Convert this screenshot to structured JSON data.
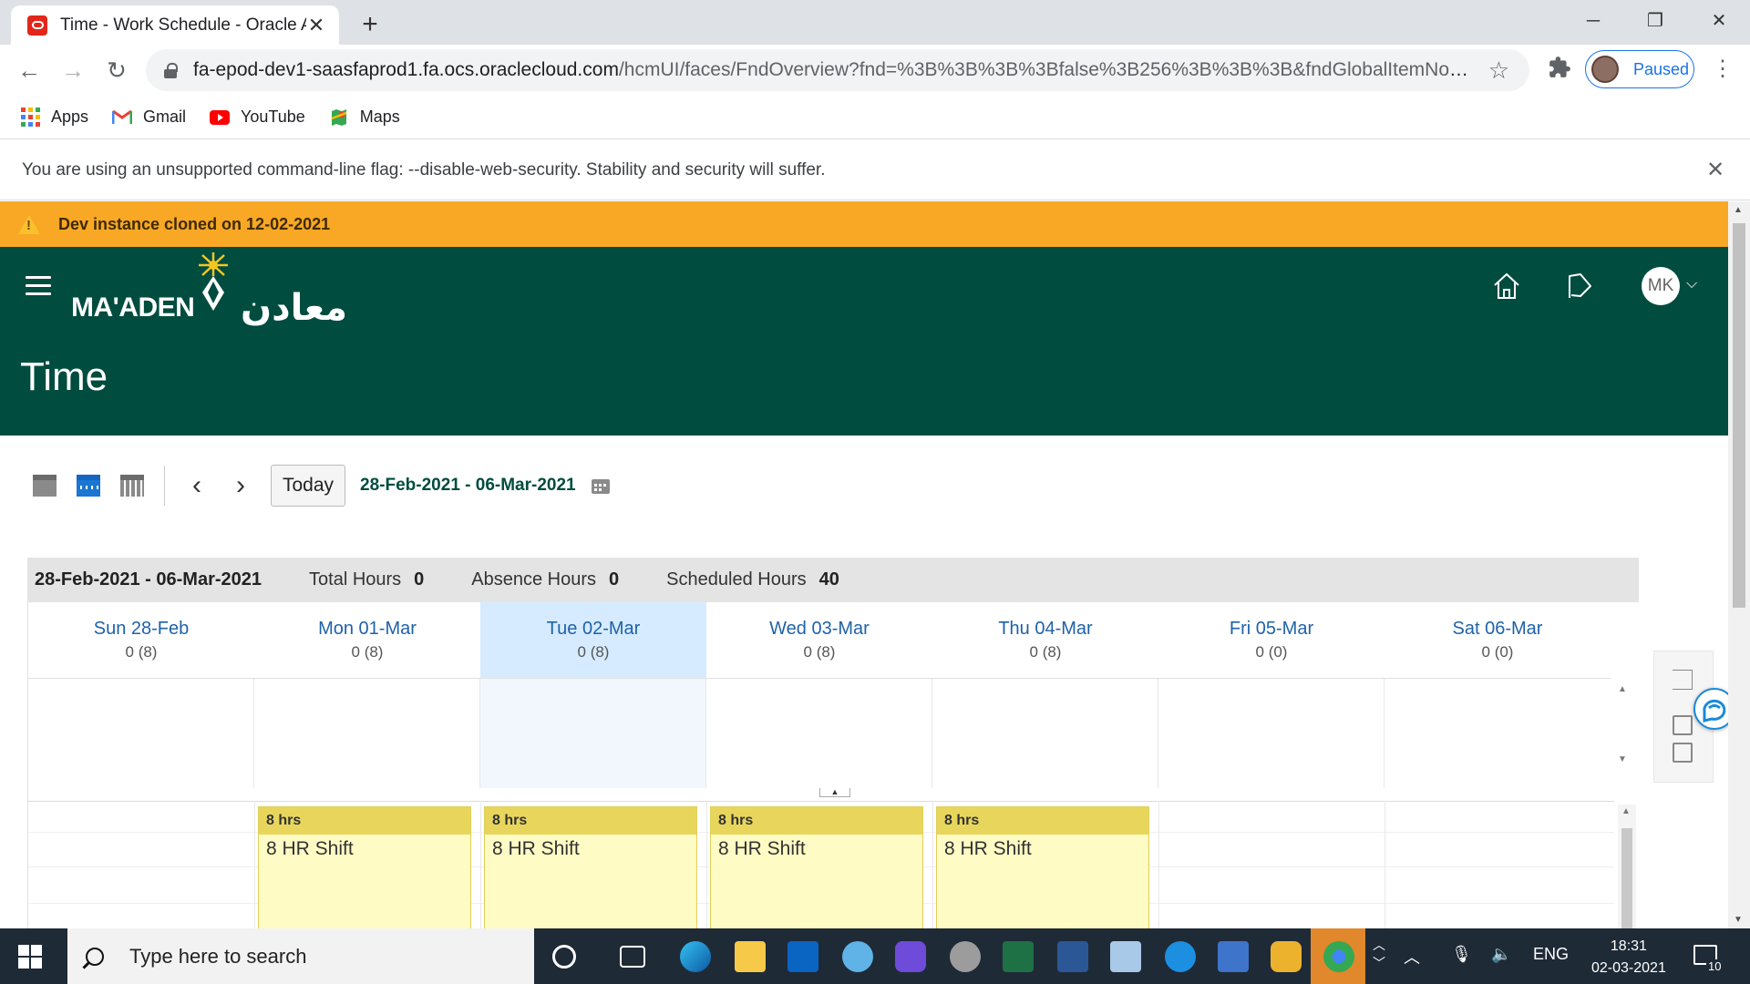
{
  "browser": {
    "tab_title": "Time - Work Schedule - Oracle Applications",
    "new_tab": "+",
    "url_host": "fa-epod-dev1-saasfaprod1.fa.ocs.oraclecloud.com",
    "url_path": "/hcmUI/faces/FndOverview?fnd=%3B%3B%3B%3Bfalse%3B256%3B%3B%3B&fndGlobalItemNodeId...",
    "profile_label": "Paused",
    "bookmarks": [
      {
        "label": "Apps",
        "icon": "apps-grid-icon"
      },
      {
        "label": "Gmail",
        "icon": "gmail-icon"
      },
      {
        "label": "YouTube",
        "icon": "youtube-icon"
      },
      {
        "label": "Maps",
        "icon": "maps-icon"
      }
    ],
    "infobar_text": "You are using an unsupported command-line flag: --disable-web-security. Stability and security will suffer."
  },
  "banner": {
    "text": "Dev instance cloned on 12-02-2021",
    "color": "#f9a825"
  },
  "header": {
    "logo_text": "MA'ADEN",
    "logo_arabic": "معادن",
    "title": "Time",
    "avatar_initials": "MK",
    "background": "#004c3f"
  },
  "calendar": {
    "today_label": "Today",
    "range": "28-Feb-2021 - 06-Mar-2021",
    "summary": {
      "range": "28-Feb-2021 - 06-Mar-2021",
      "total_label": "Total Hours",
      "total_value": "0",
      "absence_label": "Absence Hours",
      "absence_value": "0",
      "scheduled_label": "Scheduled Hours",
      "scheduled_value": "40"
    },
    "days": [
      {
        "name": "Sun 28-Feb",
        "hours": "0 (8)"
      },
      {
        "name": "Mon 01-Mar",
        "hours": "0 (8)"
      },
      {
        "name": "Tue 02-Mar",
        "hours": "0 (8)",
        "current": true
      },
      {
        "name": "Wed 03-Mar",
        "hours": "0 (8)"
      },
      {
        "name": "Thu 04-Mar",
        "hours": "0 (8)"
      },
      {
        "name": "Fri 05-Mar",
        "hours": "0 (0)"
      },
      {
        "name": "Sat 06-Mar",
        "hours": "0 (0)"
      }
    ],
    "shifts": [
      {
        "day": "Mon 01-Mar",
        "hours": "8 hrs",
        "name": "8 HR Shift"
      },
      {
        "day": "Tue 02-Mar",
        "hours": "8 hrs",
        "name": "8 HR Shift"
      },
      {
        "day": "Wed 03-Mar",
        "hours": "8 hrs",
        "name": "8 HR Shift"
      },
      {
        "day": "Thu 04-Mar",
        "hours": "8 hrs",
        "name": "8 HR Shift"
      }
    ]
  },
  "taskbar": {
    "search_placeholder": "Type here to search",
    "language": "ENG",
    "time": "18:31",
    "date": "02-03-2021",
    "notification_count": "10"
  }
}
